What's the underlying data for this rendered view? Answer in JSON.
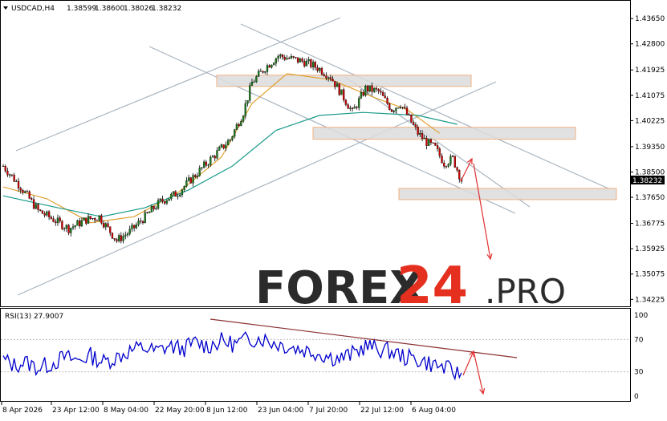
{
  "chart_data": [
    {
      "type": "candlestick",
      "header": {
        "symbol_timeframe": "USDCAD,H4",
        "open": "1.38599",
        "high": "1.38600",
        "low": "1.38026",
        "close": "1.38232"
      },
      "y_axis_ticks": [
        "1.43650",
        "1.42800",
        "1.41925",
        "1.41075",
        "1.40225",
        "1.39350",
        "1.38500",
        "1.37650",
        "1.36775",
        "1.35925",
        "1.35075",
        "1.34225"
      ],
      "ylim": [
        1.3418,
        1.4395
      ],
      "current_price": "1.38232",
      "x_axis_ticks": [
        "8 Apr 2026",
        "23 Apr 12:00",
        "8 May 04:00",
        "22 May 20:00",
        "8 Jun 12:00",
        "23 Jun 04:00",
        "7 Jul 20:00",
        "22 Jul 12:00",
        "6 Aug 04:00"
      ],
      "price_path": [
        [
          0,
          1.387
        ],
        [
          8,
          1.38
        ],
        [
          16,
          1.372
        ],
        [
          22,
          1.3695
        ],
        [
          30,
          1.366
        ],
        [
          38,
          1.369
        ],
        [
          44,
          1.37
        ],
        [
          52,
          1.362
        ],
        [
          58,
          1.365
        ],
        [
          65,
          1.37
        ],
        [
          72,
          1.375
        ],
        [
          80,
          1.378
        ],
        [
          88,
          1.384
        ],
        [
          96,
          1.39
        ],
        [
          104,
          1.396
        ],
        [
          110,
          1.405
        ],
        [
          114,
          1.415
        ],
        [
          120,
          1.42
        ],
        [
          126,
          1.424
        ],
        [
          132,
          1.423
        ],
        [
          138,
          1.422
        ],
        [
          144,
          1.42
        ],
        [
          150,
          1.417
        ],
        [
          156,
          1.41
        ],
        [
          160,
          1.405
        ],
        [
          166,
          1.413
        ],
        [
          172,
          1.412
        ],
        [
          178,
          1.406
        ],
        [
          182,
          1.408
        ],
        [
          186,
          1.403
        ],
        [
          190,
          1.398
        ],
        [
          194,
          1.395
        ],
        [
          198,
          1.393
        ],
        [
          202,
          1.388
        ],
        [
          206,
          1.3895
        ],
        [
          210,
          1.3823
        ]
      ],
      "moving_averages": [
        {
          "color": "#e0a030",
          "values": [
            [
              0,
              1.38
            ],
            [
              20,
              1.376
            ],
            [
              40,
              1.368
            ],
            [
              60,
              1.37
            ],
            [
              80,
              1.378
            ],
            [
              100,
              1.39
            ],
            [
              114,
              1.408
            ],
            [
              130,
              1.418
            ],
            [
              150,
              1.416
            ],
            [
              170,
              1.41
            ],
            [
              185,
              1.406
            ],
            [
              200,
              1.398
            ]
          ]
        },
        {
          "color": "#1a9a8a",
          "values": [
            [
              0,
              1.377
            ],
            [
              25,
              1.373
            ],
            [
              45,
              1.37
            ],
            [
              65,
              1.373
            ],
            [
              85,
              1.379
            ],
            [
              105,
              1.387
            ],
            [
              125,
              1.399
            ],
            [
              145,
              1.404
            ],
            [
              165,
              1.405
            ],
            [
              190,
              1.404
            ],
            [
              208,
              1.401
            ]
          ]
        }
      ],
      "support_resistance_zones": [
        {
          "from": 1.4175,
          "to": 1.4155
        },
        {
          "from": 1.4,
          "to": 1.396
        },
        {
          "from": 1.3795,
          "to": 1.376
        }
      ],
      "forecast_arrows_color": "#e03030",
      "colors": {
        "bull": "#1a7a1a",
        "bear": "#cc0000",
        "trendline": "#a8b4c0"
      }
    },
    {
      "type": "line",
      "title": "RSI(13) 27.9007",
      "y_ticks": [
        "100",
        "70",
        "30",
        "0"
      ],
      "ylim": [
        0,
        100
      ],
      "levels": [
        70,
        30
      ],
      "rsi_path": [
        [
          0,
          45
        ],
        [
          5,
          38
        ],
        [
          10,
          42
        ],
        [
          16,
          35
        ],
        [
          22,
          40
        ],
        [
          28,
          48
        ],
        [
          34,
          44
        ],
        [
          40,
          50
        ],
        [
          46,
          42
        ],
        [
          52,
          48
        ],
        [
          58,
          56
        ],
        [
          64,
          60
        ],
        [
          70,
          55
        ],
        [
          76,
          62
        ],
        [
          82,
          58
        ],
        [
          88,
          66
        ],
        [
          94,
          62
        ],
        [
          100,
          68
        ],
        [
          106,
          64
        ],
        [
          112,
          70
        ],
        [
          118,
          72
        ],
        [
          124,
          66
        ],
        [
          130,
          62
        ],
        [
          136,
          58
        ],
        [
          142,
          55
        ],
        [
          148,
          50
        ],
        [
          154,
          46
        ],
        [
          160,
          52
        ],
        [
          166,
          62
        ],
        [
          172,
          58
        ],
        [
          178,
          55
        ],
        [
          184,
          48
        ],
        [
          190,
          45
        ],
        [
          196,
          40
        ],
        [
          202,
          35
        ],
        [
          208,
          28
        ]
      ],
      "rsi_color": "#0000cc",
      "trendline_color": "#8b3030"
    }
  ],
  "watermark": {
    "brand_main": "FOREX",
    "brand_number": "24",
    "brand_suffix": ".PRO"
  }
}
